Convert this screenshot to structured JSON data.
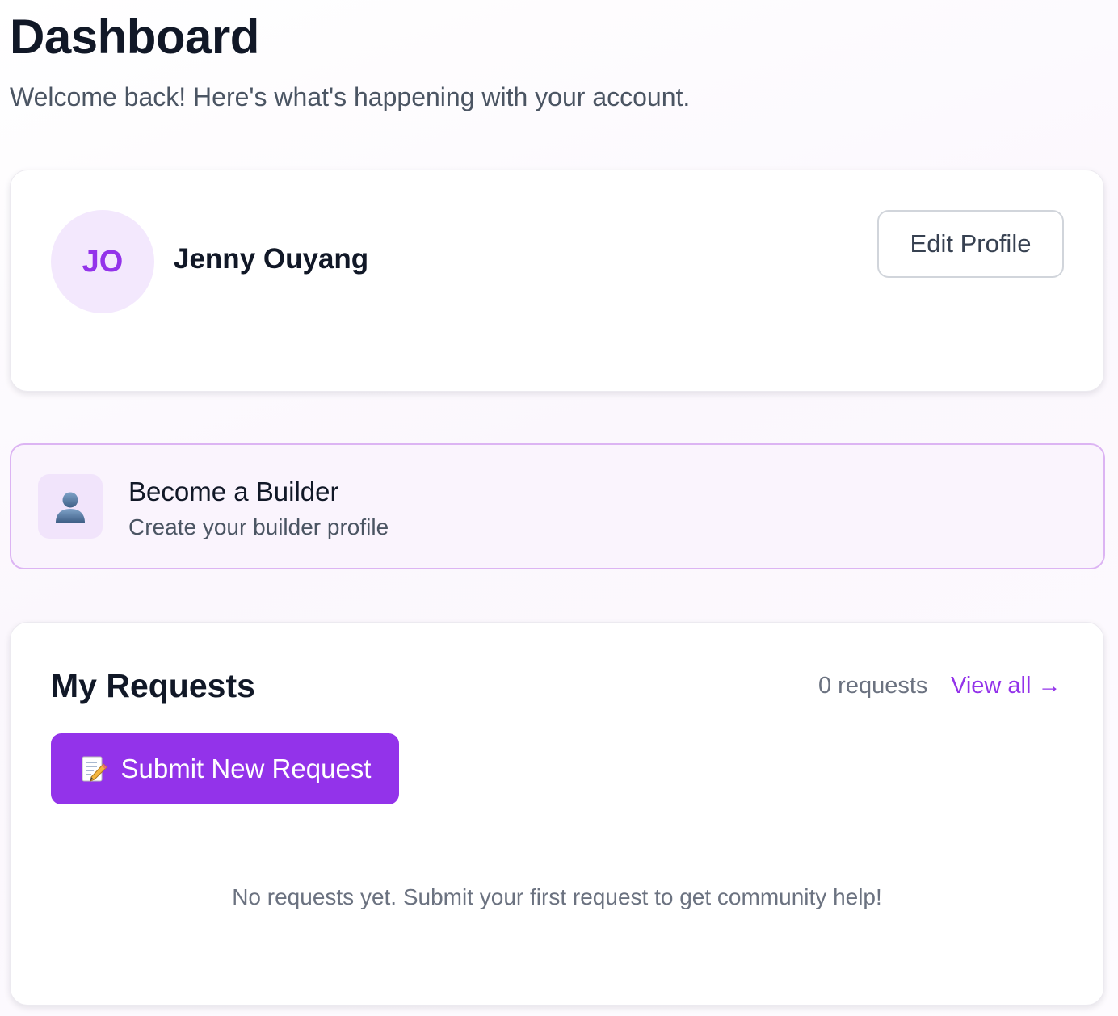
{
  "header": {
    "title": "Dashboard",
    "subtitle": "Welcome back! Here's what's happening with your account."
  },
  "profile": {
    "initials": "JO",
    "name": "Jenny Ouyang",
    "edit_label": "Edit Profile"
  },
  "builder_cta": {
    "icon": "person-silhouette-icon",
    "title": "Become a Builder",
    "subtitle": "Create your builder profile"
  },
  "requests": {
    "title": "My Requests",
    "count_label": "0 requests",
    "view_all_label": "View all →",
    "submit_icon": "memo-icon",
    "submit_label": "Submit New Request",
    "empty_message": "No requests yet. Submit your first request to get community help!"
  },
  "colors": {
    "accent": "#9333ea",
    "avatar_bg": "#f3e8fd",
    "builder_card_bg": "#faf4fd",
    "builder_card_border": "#dcb4f3"
  }
}
